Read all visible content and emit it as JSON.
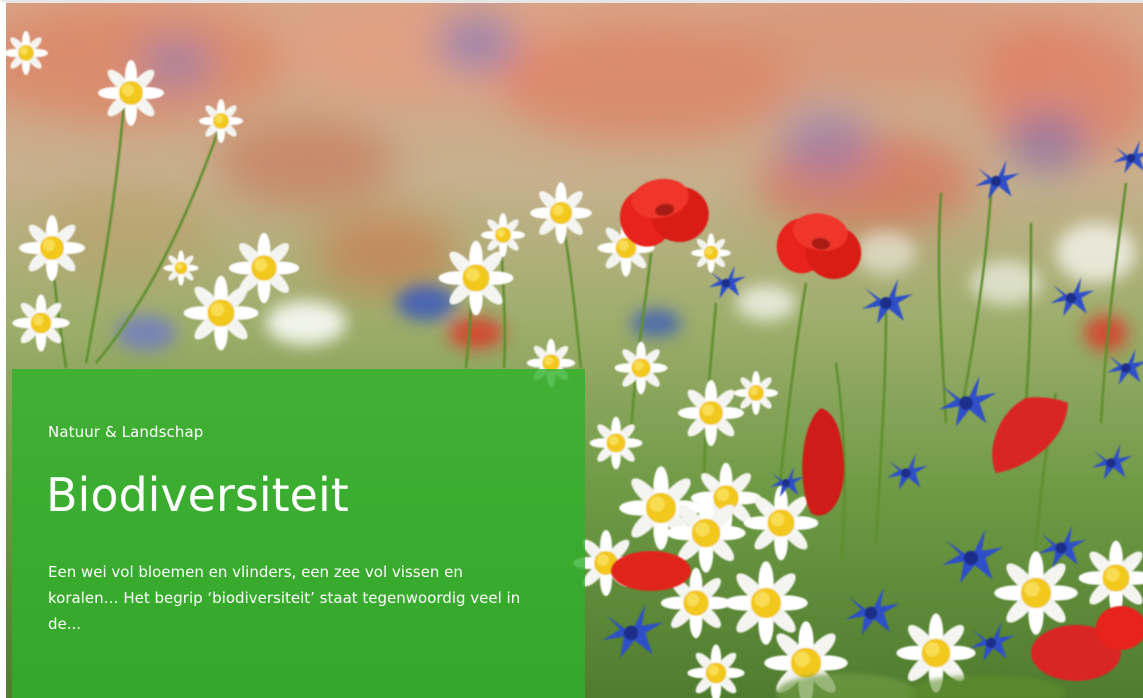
{
  "card": {
    "category": "Natuur & Landschap",
    "title": "Biodiversiteit",
    "description": "Een wei vol bloemen en vlinders, een zee vol vissen en koralen… Het begrip ‘biodiversiteit’ staat tegenwoordig veel in de..."
  },
  "image": {
    "subject": "wildflower-meadow-photo",
    "icons": [
      "daisy",
      "poppy",
      "cornflower"
    ]
  },
  "colors": {
    "overlay": "#2EB22A",
    "text": "#FFFFFF",
    "poppy": "#E8231A",
    "cornflower": "#2F4FC8",
    "daisy_petal": "#FFFFFF",
    "daisy_center": "#F2C81A",
    "stem": "#5E8F2E"
  }
}
